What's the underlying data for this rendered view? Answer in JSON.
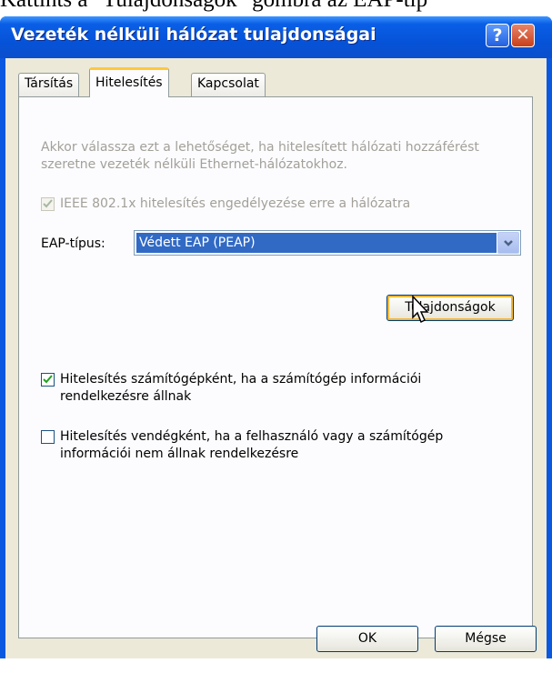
{
  "document": {
    "partial_text": "Kattints a \"Tulajdonságok\" gombra az EAP-típ"
  },
  "window": {
    "title": "Vezeték nélküli hálózat tulajdonságai",
    "help_glyph": "?",
    "close_glyph": "✕"
  },
  "tabs": [
    {
      "label": "Társítás",
      "active": false
    },
    {
      "label": "Hitelesítés",
      "active": true
    },
    {
      "label": "Kapcsolat",
      "active": false
    }
  ],
  "auth": {
    "description": "Akkor válassza ezt a lehetőséget, ha hitelesített hálózati hozzáférést szeretne vezeték nélküli Ethernet-hálózatokhoz.",
    "ieee_checkbox": {
      "label": "IEEE 802.1x hitelesítés engedélyezése erre a hálózatra",
      "checked": true,
      "enabled": false
    },
    "eap_label": "EAP-típus:",
    "eap_value": "Védett EAP (PEAP)",
    "properties_button": "Tulajdonságok",
    "computer_auth": {
      "label": "Hitelesítés számítógépként, ha a számítógép információi rendelkezésre állnak",
      "checked": true
    },
    "guest_auth": {
      "label": "Hitelesítés vendégként, ha a felhasználó vagy a számítógép információi nem állnak rendelkezésre",
      "checked": false
    }
  },
  "footer": {
    "ok_label": "OK",
    "cancel_label": "Mégse"
  },
  "colors": {
    "title_bar": "#0a5fe6",
    "selection": "#316ac5",
    "focus": "#f8b636"
  }
}
